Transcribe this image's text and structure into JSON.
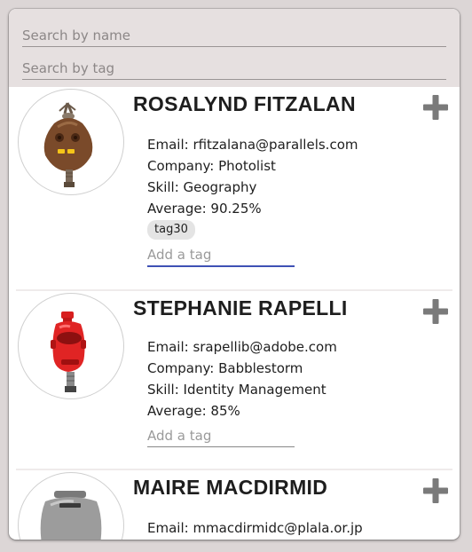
{
  "search": {
    "name_placeholder": "Search by name",
    "tag_placeholder": "Search by tag"
  },
  "add_tag_placeholder": "Add a tag",
  "students": [
    {
      "name": "ROSALYND FITZALAN",
      "email": "Email: rfitzalana@parallels.com",
      "company": "Company: Photolist",
      "skill": "Skill: Geography",
      "average": "Average: 90.25%",
      "tags": [
        "tag30"
      ],
      "avatar_icon": "brown-robot-icon"
    },
    {
      "name": "STEPHANIE RAPELLI",
      "email": "Email: srapellib@adobe.com",
      "company": "Company: Babblestorm",
      "skill": "Skill: Identity Management",
      "average": "Average: 85%",
      "tags": [],
      "avatar_icon": "red-robot-icon"
    },
    {
      "name": "MAIRE MACDIRMID",
      "email": "Email: mmacdirmidc@plala.or.jp",
      "avatar_icon": "gray-robot-icon"
    }
  ],
  "colors": {
    "background": "#dcd6d6",
    "search_bar": "#e6e0e0",
    "focus_underline": "#3f51b5",
    "expand_icon": "#7a7a7a"
  }
}
